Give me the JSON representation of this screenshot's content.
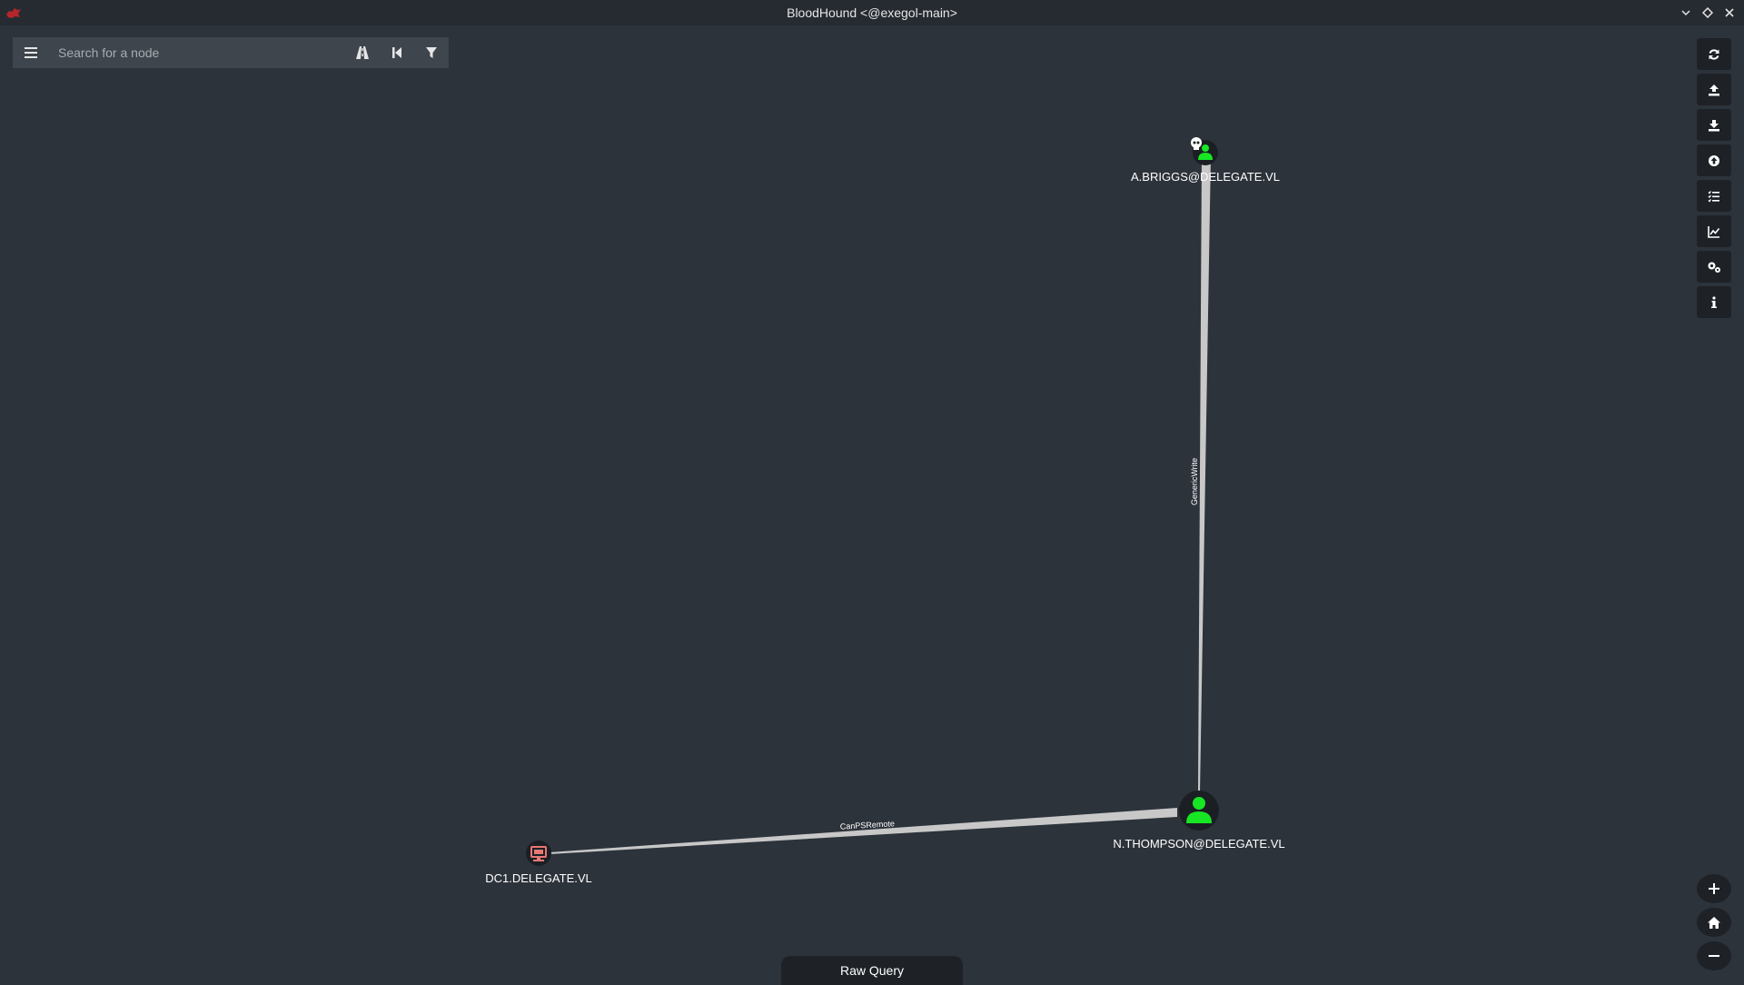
{
  "window": {
    "title": "BloodHound <@exegol-main>"
  },
  "search": {
    "placeholder": "Search for a node"
  },
  "graph": {
    "nodes": [
      {
        "label": "A.BRIGGS@DELEGATE.VL",
        "type": "user",
        "owned": true
      },
      {
        "label": "N.THOMPSON@DELEGATE.VL",
        "type": "user",
        "owned": false
      },
      {
        "label": "DC1.DELEGATE.VL",
        "type": "computer",
        "owned": false
      }
    ],
    "edges": [
      {
        "label": "GenericWrite",
        "from": "A.BRIGGS@DELEGATE.VL",
        "to": "N.THOMPSON@DELEGATE.VL"
      },
      {
        "label": "CanPSRemote",
        "from": "N.THOMPSON@DELEGATE.VL",
        "to": "DC1.DELEGATE.VL"
      }
    ]
  },
  "right_toolbar": {
    "icons": [
      "refresh-icon",
      "upload-icon",
      "download-icon",
      "upload-data-icon",
      "query-list-icon",
      "stats-icon",
      "settings-icon",
      "info-icon"
    ]
  },
  "zoom": {
    "icons": [
      "zoom-in-icon",
      "home-icon",
      "zoom-out-icon"
    ]
  },
  "raw_query": {
    "label": "Raw Query"
  },
  "colors": {
    "background": "#2d333b",
    "user_node": "#17e625",
    "computer_node": "#e67873",
    "edge": "#c8c8c8",
    "panel": "#1e2227"
  }
}
